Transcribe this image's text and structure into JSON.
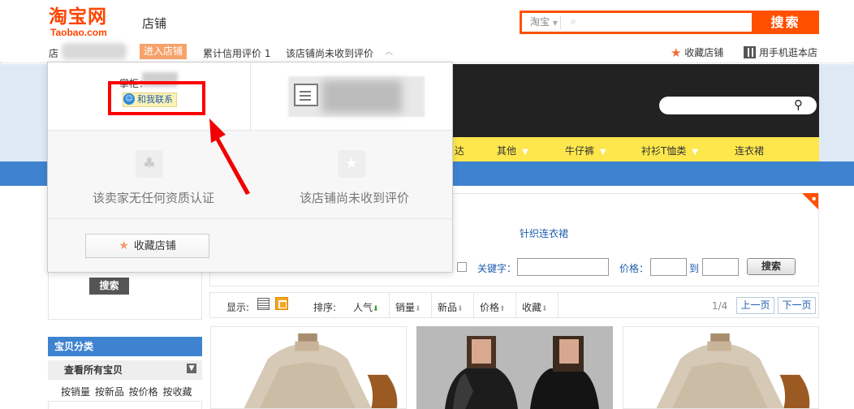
{
  "header": {
    "logo_cn": "淘宝网",
    "logo_en": "Taobao.com",
    "shop_label": "店铺",
    "search": {
      "scope": "淘宝",
      "placeholder": "",
      "button": "搜索"
    }
  },
  "nav": {
    "store_prefix": "店",
    "enter_store": "进入店铺",
    "credit": "累计信用评价 1",
    "no_review": "该店铺尚未收到评价",
    "favorite": "收藏店铺",
    "mobile": "用手机逛本店"
  },
  "banner": {
    "categories": [
      "达",
      "其他",
      "牛仔裤",
      "衬衫T恤类",
      "连衣裙"
    ]
  },
  "popup": {
    "owner_label": "掌柜：",
    "contact": "和我联系",
    "cert": "该卖家无任何资质认证",
    "no_review": "该店铺尚未收到评价",
    "favorite": "收藏店铺"
  },
  "filter": {
    "link": "针织连衣裙",
    "keyword_label": "关键字：",
    "price_label": "价格：",
    "to": "到",
    "button": "搜索"
  },
  "left": {
    "search_button": "搜索",
    "category_head": "宝贝分类",
    "view_all": "查看所有宝贝",
    "sorts": "按销量 按新品 按价格 按收藏"
  },
  "toolbar": {
    "display": "显示:",
    "sort": "排序:",
    "sort_popular": "人气",
    "sort_sales": "销量",
    "sort_new": "新品",
    "sort_price": "价格",
    "sort_fav": "收藏",
    "page": "1/4",
    "prev": "上一页",
    "next": "下一页"
  },
  "colors": {
    "brand": "#ff5000",
    "link": "#1f5dac",
    "highlight_box": "#ff0000",
    "shop_blue": "#3e83d0",
    "shop_yellow": "#fde74c"
  }
}
